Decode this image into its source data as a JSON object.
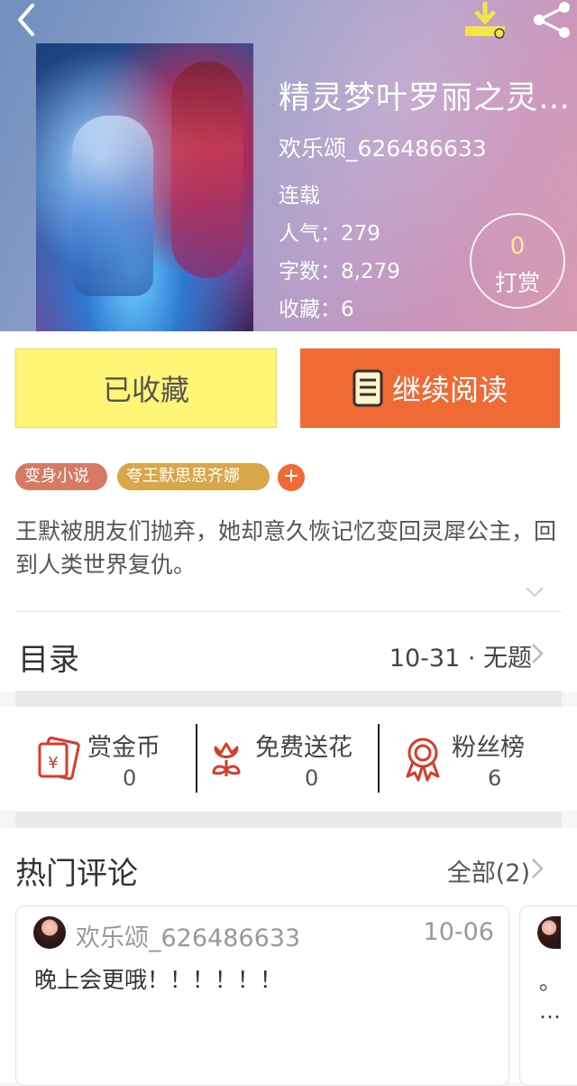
{
  "header": {
    "back_icon": "chevron-left-icon",
    "download_icon": "download-icon",
    "share_icon": "share-icon"
  },
  "book": {
    "title": "精灵梦叶罗丽之灵…",
    "author": "欢乐颂_626486633",
    "status": "连载",
    "popularity": "人气：279",
    "word_count": "字数：8,279",
    "favorites": "收藏：6"
  },
  "tip": {
    "count": "0",
    "label": "打赏"
  },
  "actions": {
    "collected_label": "已收藏",
    "continue_label": "继续阅读"
  },
  "tags": {
    "items": [
      "变身小说",
      "夸王默思思齐娜"
    ],
    "add_label": "+"
  },
  "description": "王默被朋友们抛弃，她却意久恢记忆变回灵犀公主，回到人类世界复仇。",
  "toc": {
    "title": "目录",
    "latest": "10-31 · 无题"
  },
  "stats": [
    {
      "label": "赏金币",
      "value": "0",
      "icon": "red-envelope-icon"
    },
    {
      "label": "免费送花",
      "value": "0",
      "icon": "flower-icon"
    },
    {
      "label": "粉丝榜",
      "value": "6",
      "icon": "ribbon-badge-icon"
    }
  ],
  "comments": {
    "title": "热门评论",
    "all_label": "全部(2)",
    "items": [
      {
        "user": "欢乐颂_626486633",
        "date": "10-06",
        "text": "晚上会更哦！！！！！！"
      },
      {
        "text": "。\n…"
      }
    ]
  },
  "colors": {
    "accent": "#f06a35",
    "collected_bg": "#fff678",
    "tag1": "#d77a63",
    "tag2": "#d9a74a",
    "icon_red": "#d93a2a"
  }
}
